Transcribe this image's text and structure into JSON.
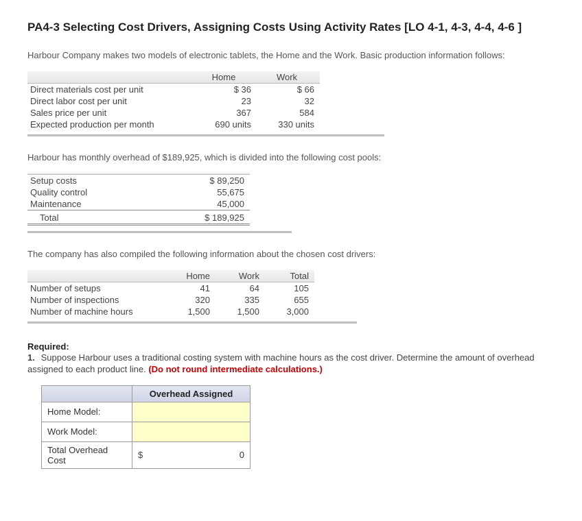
{
  "title": "PA4-3 Selecting Cost Drivers, Assigning Costs Using Activity Rates [LO 4-1, 4-3, 4-4, 4-6 ]",
  "intro": "Harbour Company makes two models of electronic tablets, the Home and the Work. Basic production information follows:",
  "table1": {
    "headers": {
      "home": "Home",
      "work": "Work"
    },
    "rows": [
      {
        "label": "Direct materials cost per unit",
        "home": "$  36",
        "work": "$  66"
      },
      {
        "label": "Direct labor cost per unit",
        "home": "23",
        "work": "32"
      },
      {
        "label": "Sales price per unit",
        "home": "367",
        "work": "584"
      },
      {
        "label": "Expected production per month",
        "home": "690 units",
        "work": "330 units"
      }
    ]
  },
  "overhead_text": "Harbour has monthly overhead of $189,925, which is divided into the following cost pools:",
  "table2": {
    "rows": [
      {
        "label": "Setup costs",
        "amount": "$  89,250"
      },
      {
        "label": "Quality control",
        "amount": "55,675"
      },
      {
        "label": "Maintenance",
        "amount": "45,000"
      }
    ],
    "total_label": "Total",
    "total_amount": "$ 189,925"
  },
  "drivers_text": "The company has also compiled the following information about the chosen cost drivers:",
  "table3": {
    "headers": {
      "home": "Home",
      "work": "Work",
      "total": "Total"
    },
    "rows": [
      {
        "label": "Number of setups",
        "home": "41",
        "work": "64",
        "total": "105"
      },
      {
        "label": "Number of inspections",
        "home": "320",
        "work": "335",
        "total": "655"
      },
      {
        "label": "Number of machine hours",
        "home": "1,500",
        "work": "1,500",
        "total": "3,000"
      }
    ]
  },
  "required_label": "Required:",
  "req1": {
    "num": "1.",
    "text": "Suppose Harbour uses a traditional costing system with machine hours as the cost driver. Determine the amount of overhead assigned to each product line. ",
    "red": "(Do not round intermediate calculations.)"
  },
  "answer": {
    "header": "Overhead Assigned",
    "rows": {
      "home_label": "Home Model:",
      "work_label": "Work Model:",
      "total_label": "Total Overhead Cost",
      "total_sym": "$",
      "total_val": "0"
    }
  }
}
